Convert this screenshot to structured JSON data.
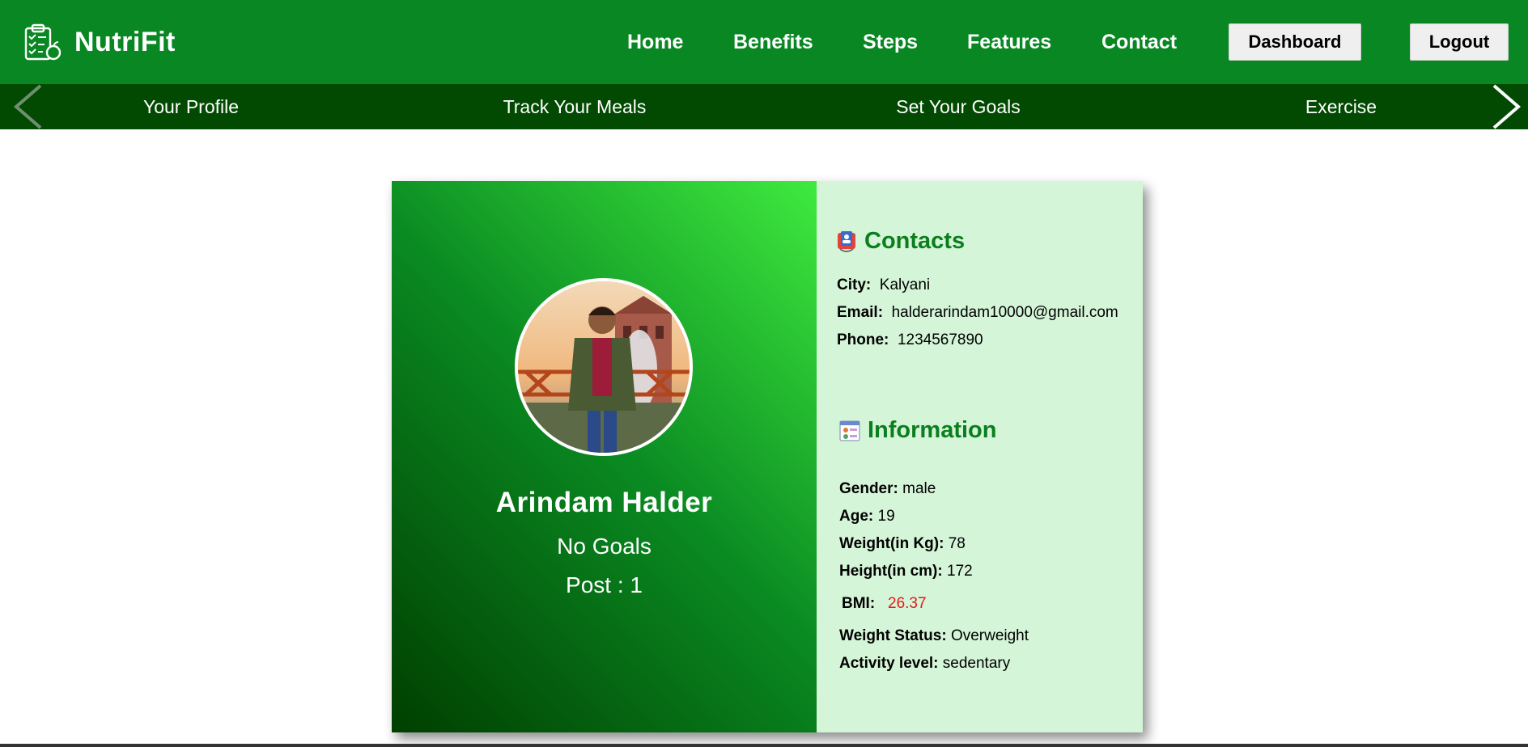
{
  "brand": {
    "name": "NutriFit",
    "icon": "clipboard-apple-icon"
  },
  "nav": {
    "links": [
      "Home",
      "Benefits",
      "Steps",
      "Features",
      "Contact"
    ],
    "dashboard_label": "Dashboard",
    "logout_label": "Logout"
  },
  "subnav": {
    "items": [
      "Your Profile",
      "Track Your Meals",
      "Set Your Goals",
      "Exercise"
    ],
    "prev_icon": "chevron-left-icon",
    "next_icon": "chevron-right-icon"
  },
  "profile": {
    "name": "Arindam Halder",
    "goal": "No Goals",
    "post": "Post : 1"
  },
  "contacts": {
    "title": "Contacts",
    "icon": "contact-book-icon",
    "city_label": "City:",
    "city": "Kalyani",
    "email_label": "Email:",
    "email": "halderarindam10000@gmail.com",
    "phone_label": "Phone:",
    "phone": "1234567890"
  },
  "information": {
    "title": "Information",
    "icon": "info-chart-icon",
    "gender_label": "Gender:",
    "gender": "male",
    "age_label": "Age:",
    "age": "19",
    "weight_label": "Weight(in Kg):",
    "weight": "78",
    "height_label": "Height(in cm):",
    "height": "172",
    "bmi_label": "BMI:",
    "bmi": "26.37",
    "status_label": "Weight Status:",
    "status": "Overweight",
    "activity_label": "Activity level:",
    "activity": "sedentary"
  },
  "colors": {
    "navbar": "#088723",
    "subnav": "#024a02",
    "accent_heading": "#0b7e1e",
    "panel_bg": "#d5f5d8",
    "bmi_value": "#e21a1a"
  }
}
